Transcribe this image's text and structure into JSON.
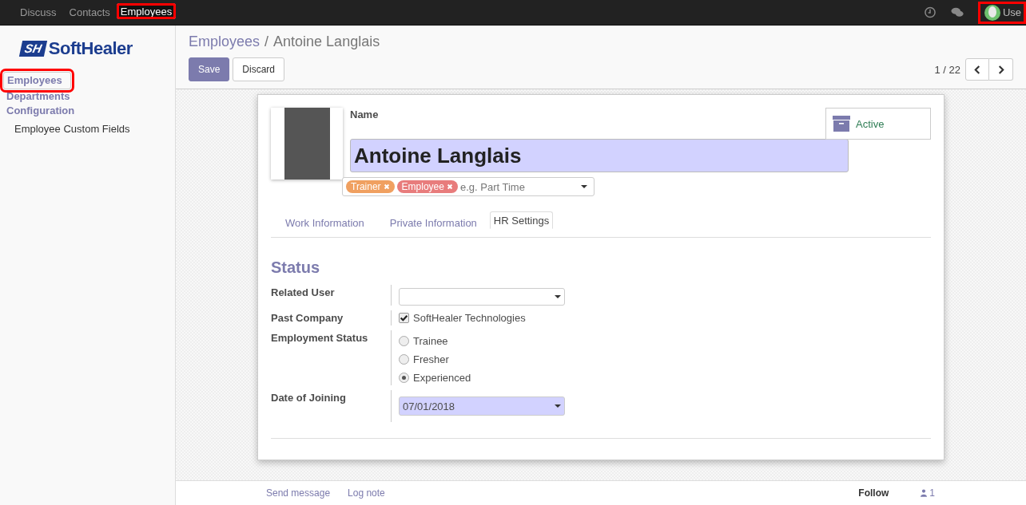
{
  "top_menu": {
    "items": [
      {
        "label": "Discuss",
        "selected": false,
        "highlighted": false
      },
      {
        "label": "Contacts",
        "selected": false,
        "highlighted": false
      },
      {
        "label": "Employees",
        "selected": true,
        "highlighted": true
      }
    ],
    "user": {
      "label": "Use",
      "highlighted": true
    }
  },
  "sidebar": {
    "logo": {
      "mark": "SH",
      "text": "SoftHealer"
    },
    "items": [
      {
        "label": "Employees",
        "selected": true,
        "highlighted": true
      },
      {
        "label": "Departments",
        "selected": false,
        "highlighted": false
      },
      {
        "label": "Configuration",
        "selected": false,
        "highlighted": false,
        "children": [
          {
            "label": "Employee Custom Fields",
            "selected": false,
            "highlighted": false
          }
        ]
      }
    ]
  },
  "control_panel": {
    "breadcrumb": [
      "Employees",
      "Antoine Langlais"
    ],
    "breadcrumb_separator": "/",
    "buttons": [
      {
        "label": "Save",
        "kind": "primary"
      },
      {
        "label": "Discard",
        "kind": "secondary"
      }
    ],
    "pager": "1 / 22"
  },
  "form": {
    "name_label": "Name",
    "name": "Antoine Langlais",
    "active_button": "Active",
    "tags": [
      {
        "label": "Trainer",
        "color": "#f0a060"
      },
      {
        "label": "Employee",
        "color": "#e87c7c"
      }
    ],
    "tags_placeholder": "e.g. Part Time",
    "tabs": [
      {
        "label": "Work Information",
        "selected": false
      },
      {
        "label": "Private Information",
        "selected": false
      },
      {
        "label": "HR Settings",
        "selected": true
      }
    ],
    "section_title": "Status",
    "fields": [
      {
        "label": "Related User",
        "kind": "select"
      },
      {
        "label": "Past Company",
        "kind": "checkbox",
        "options": [
          {
            "label": "SoftHealer Technologies",
            "checked": true
          }
        ]
      },
      {
        "label": "Employment Status",
        "kind": "radio",
        "options": [
          {
            "label": "Trainee",
            "selected": false
          },
          {
            "label": "Fresher",
            "selected": false
          },
          {
            "label": "Experienced",
            "selected": true
          }
        ]
      },
      {
        "label": "Date of Joining",
        "kind": "date",
        "value": "07/01/2018"
      }
    ]
  },
  "chatter": {
    "links": [
      "Send message",
      "Log note"
    ],
    "follow": "Follow",
    "followers": "1"
  }
}
